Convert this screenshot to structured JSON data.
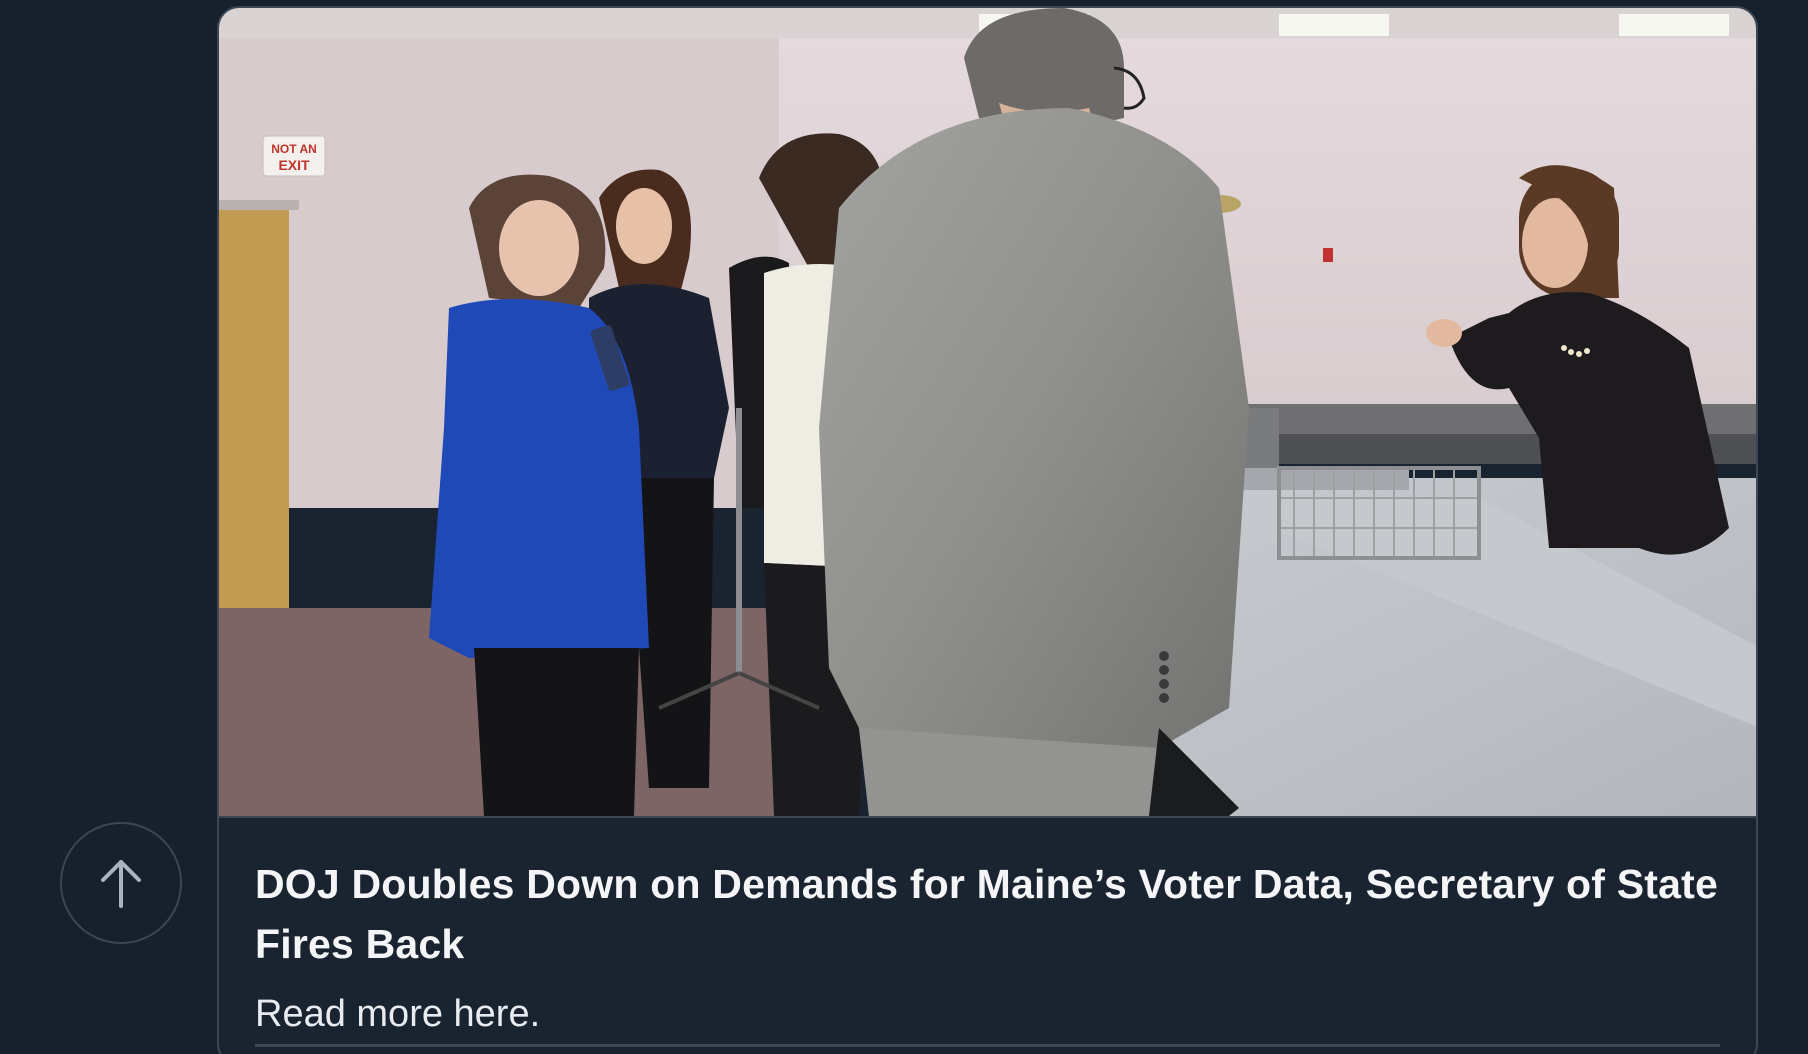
{
  "scroll_top": {
    "icon": "arrow-up-icon"
  },
  "card": {
    "image_alt": "Group of people talking in a meeting room",
    "title": "DOJ Doubles Down on Demands for Maine’s Voter Data, Secretary of State Fires Back",
    "description": "Read more here.",
    "sign_text": "NOT AN EXIT"
  },
  "colors": {
    "background": "#17202b",
    "card_border": "#3b4656",
    "title_text": "#f3f5f7"
  }
}
